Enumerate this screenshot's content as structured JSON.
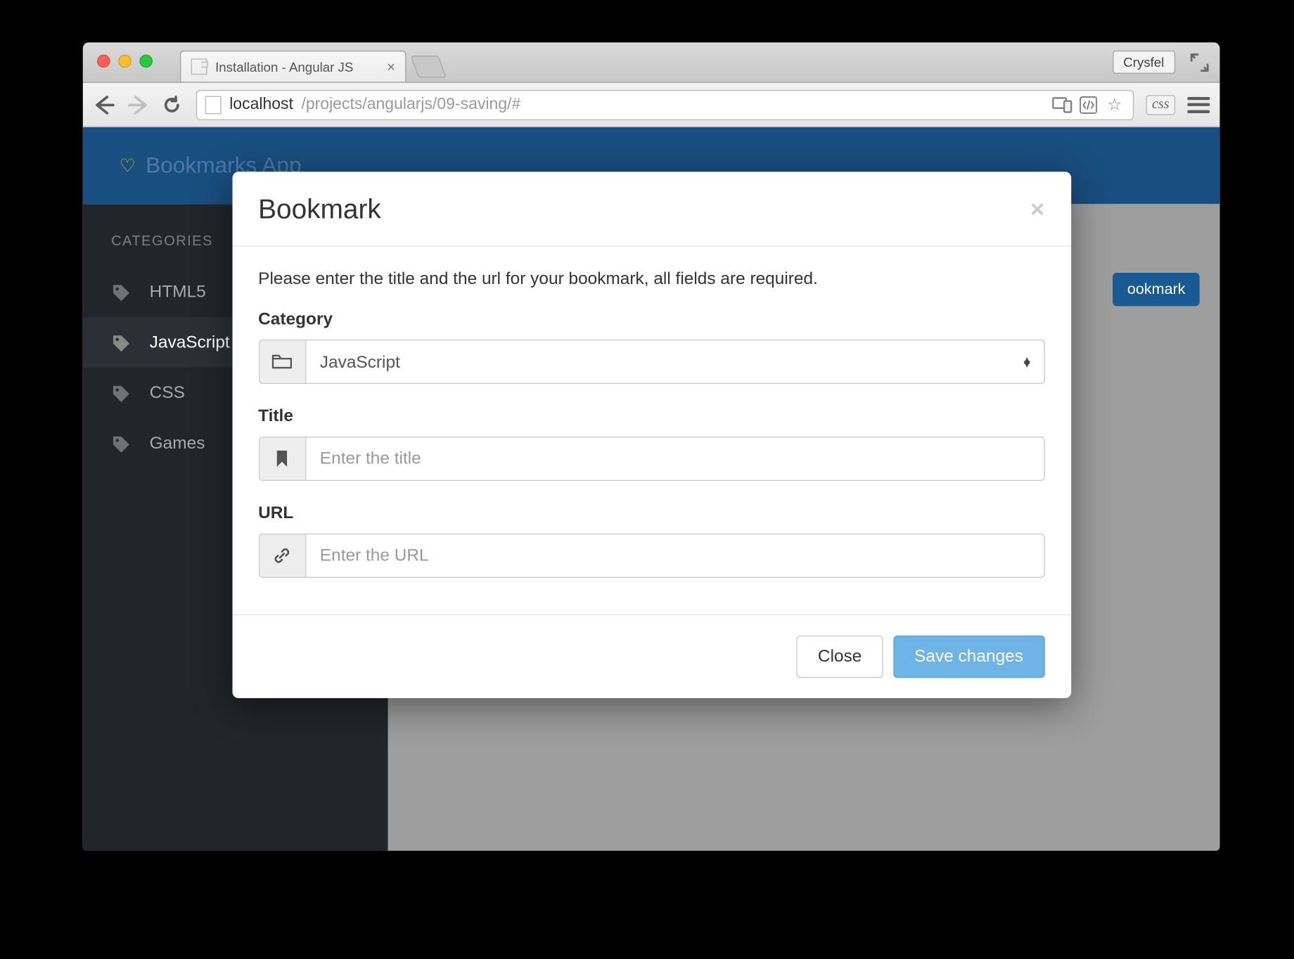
{
  "browser": {
    "tab_title": "Installation - Angular JS",
    "user_label": "Crysfel",
    "url_host": "localhost",
    "url_path": "/projects/angularjs/09-saving/#",
    "css_button": "css"
  },
  "app": {
    "title": "Bookmarks App",
    "sidebar_heading": "CATEGORIES",
    "categories": [
      {
        "label": "HTML5",
        "active": false
      },
      {
        "label": "JavaScript",
        "active": true
      },
      {
        "label": "CSS",
        "active": false
      },
      {
        "label": "Games",
        "active": false
      }
    ],
    "add_button_partial": "ookmark"
  },
  "modal": {
    "title": "Bookmark",
    "intro": "Please enter the title and the url for your bookmark, all fields are required.",
    "fields": {
      "category": {
        "label": "Category",
        "value": "JavaScript"
      },
      "title": {
        "label": "Title",
        "placeholder": "Enter the title"
      },
      "url": {
        "label": "URL",
        "placeholder": "Enter the URL"
      }
    },
    "buttons": {
      "close": "Close",
      "save": "Save changes"
    }
  }
}
